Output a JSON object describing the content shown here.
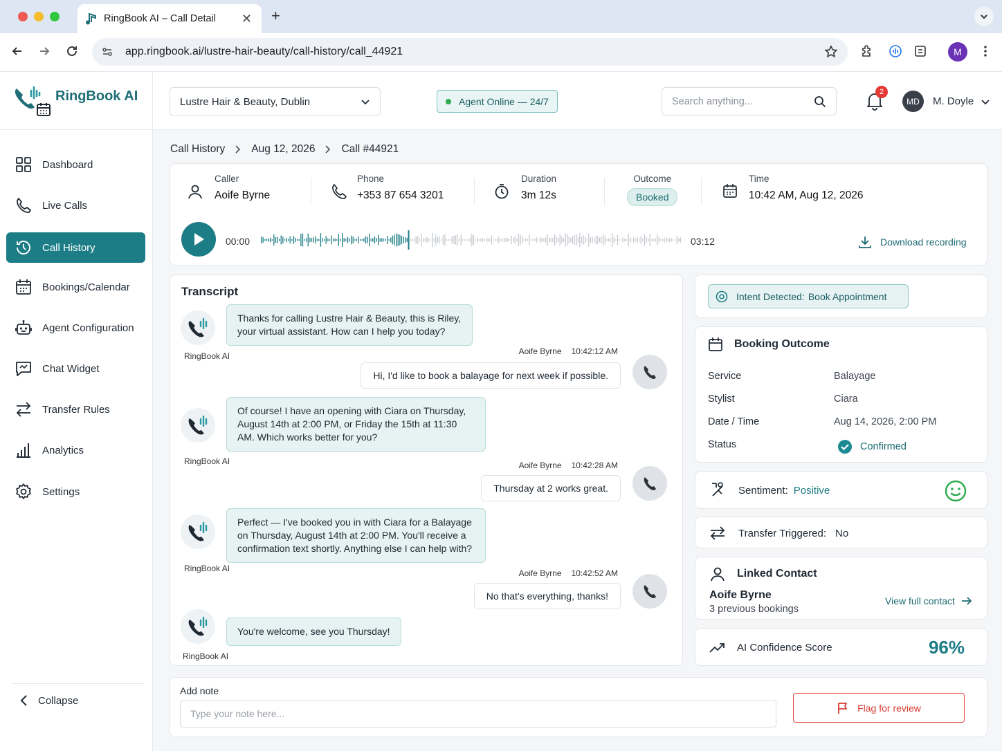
{
  "browser": {
    "tab_title": "RingBook AI – Call Detail",
    "url": "app.ringbook.ai/lustre-hair-beauty/call-history/call_44921",
    "profile_initial": "M"
  },
  "app": {
    "logo_text": "RingBook AI"
  },
  "sidebar": {
    "items": [
      {
        "label": "Dashboard"
      },
      {
        "label": "Live Calls"
      },
      {
        "label": "Call History"
      },
      {
        "label": "Bookings/Calendar"
      },
      {
        "label": "Agent Configuration"
      },
      {
        "label": "Chat Widget"
      },
      {
        "label": "Transfer Rules"
      },
      {
        "label": "Analytics"
      },
      {
        "label": "Settings"
      }
    ],
    "collapse_label": "Collapse"
  },
  "header": {
    "business": "Lustre Hair & Beauty, Dublin",
    "agent_status": "Agent Online — 24/7",
    "search_placeholder": "Search anything...",
    "notifications_count": "2",
    "user_initials": "MD",
    "user_name": "M. Doyle"
  },
  "breadcrumb": {
    "root": "Call History",
    "date": "Aug 12, 2026",
    "call": "Call #44921"
  },
  "call": {
    "caller_label": "Caller",
    "caller": "Aoife Byrne",
    "phone_label": "Phone",
    "phone": "+353 87 654 3201",
    "duration_label": "Duration",
    "duration": "3m 12s",
    "outcome_label": "Outcome",
    "outcome": "Booked",
    "time_label": "Time",
    "time": "10:42 AM, Aug 12, 2026",
    "player_start": "00:00",
    "player_end": "03:12",
    "progress_fraction": 0.35,
    "download_label": "Download recording"
  },
  "transcript": {
    "title": "Transcript",
    "ai_name": "RingBook AI",
    "messages": [
      {
        "from": "ai",
        "text": "Thanks for calling Lustre Hair & Beauty, this is Riley, your virtual assistant. How can I help you today?"
      },
      {
        "from": "caller",
        "name": "Aoife Byrne",
        "time": "10:42:12 AM",
        "text": "Hi, I'd like to book a balayage for next week if possible."
      },
      {
        "from": "ai",
        "text": "Of course! I have an opening with Ciara on Thursday, August 14th at 2:00 PM, or Friday the 15th at 11:30 AM. Which works better for you?"
      },
      {
        "from": "caller",
        "name": "Aoife Byrne",
        "time": "10:42:28 AM",
        "text": "Thursday at 2 works great."
      },
      {
        "from": "ai",
        "text": "Perfect — I've booked you in with Ciara for a Balayage on Thursday, August 14th at 2:00 PM. You'll receive a confirmation text shortly. Anything else I can help with?"
      },
      {
        "from": "caller",
        "name": "Aoife Byrne",
        "time": "10:42:52 AM",
        "text": "No that's everything, thanks!"
      },
      {
        "from": "ai",
        "text": "You're welcome, see you Thursday!"
      }
    ]
  },
  "intent": {
    "label": "Intent Detected:",
    "value": "Book Appointment"
  },
  "booking": {
    "title": "Booking Outcome",
    "rows": [
      {
        "key": "Service",
        "value": "Balayage"
      },
      {
        "key": "Stylist",
        "value": "Ciara"
      },
      {
        "key": "Date / Time",
        "value": "Aug 14, 2026, 2:00 PM"
      },
      {
        "key": "Status",
        "value": "Confirmed"
      }
    ]
  },
  "sentiment": {
    "label": "Sentiment:",
    "value": "Positive"
  },
  "transfer": {
    "label": "Transfer Triggered:",
    "value": "No"
  },
  "contact": {
    "title": "Linked Contact",
    "name": "Aoife Byrne",
    "bookings": "3 previous bookings",
    "link": "View full contact"
  },
  "confidence": {
    "label": "AI Confidence Score",
    "value": "96%"
  },
  "note": {
    "label": "Add note",
    "placeholder": "Type your note here...",
    "flag_label": "Flag for review"
  },
  "colors": {
    "accent": "#1d7d86",
    "accent_light": "#e6f3f2",
    "danger": "#d93a30",
    "success": "#2bab4d"
  }
}
